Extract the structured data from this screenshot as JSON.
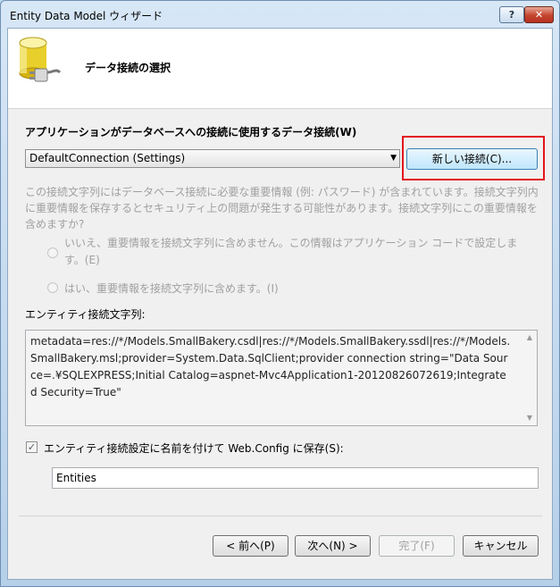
{
  "window": {
    "title": "Entity Data Model ウィザード",
    "help_label": "?",
    "close_label": "✕"
  },
  "header": {
    "title": "データ接続の選択",
    "icon": "database-plug-icon"
  },
  "connection": {
    "label": "アプリケーションがデータベースへの接続に使用するデータ接続(W)",
    "selected": "DefaultConnection (Settings)",
    "new_button": "新しい接続(C)..."
  },
  "sensitive": {
    "description": "この接続文字列にはデータベース接続に必要な重要情報 (例: パスワード) が含まれています。接続文字列内に重要情報を保存するとセキュリティ上の問題が発生する可能性があります。接続文字列にこの重要情報を含めますか?",
    "option_no": "いいえ、重要情報を接続文字列に含めません。この情報はアプリケーション コードで設定します。(E)",
    "option_yes": "はい、重要情報を接続文字列に含めます。(I)"
  },
  "entity_string": {
    "label": "エンティティ接続文字列:",
    "value": "metadata=res://*/Models.SmallBakery.csdl|res://*/Models.SmallBakery.ssdl|res://*/Models.SmallBakery.msl;provider=System.Data.SqlClient;provider connection string=\"Data Source=.¥SQLEXPRESS;Initial Catalog=aspnet-Mvc4Application1-20120826072619;Integrated Security=True\""
  },
  "save": {
    "checked": true,
    "label": "エンティティ接続設定に名前を付けて Web.Config に保存(S):",
    "name_value": "Entities"
  },
  "footer": {
    "back": "< 前へ(P)",
    "next": "次へ(N) >",
    "finish": "完了(F)",
    "cancel": "キャンセル"
  },
  "colors": {
    "highlight": "#e4141d",
    "disabled_text": "#a0a0a0"
  }
}
